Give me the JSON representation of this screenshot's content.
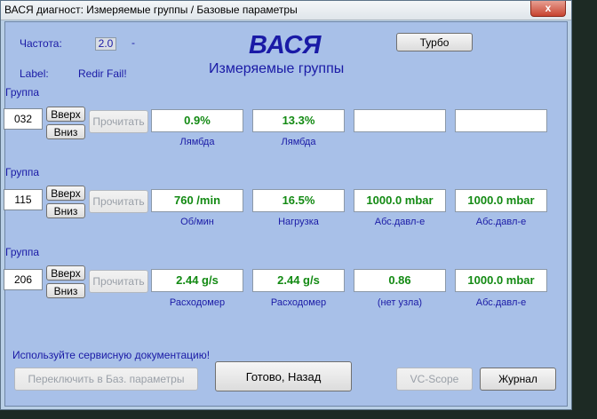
{
  "window": {
    "title": "ВАСЯ диагност: Измеряемые группы / Базовые параметры",
    "close_glyph": "x"
  },
  "header": {
    "freq_label": "Частота:",
    "freq_value": "2.0",
    "freq_dash": "-",
    "label_caption": "Label:",
    "label_value": "Redir Fail!",
    "brand": "ВАСЯ",
    "subtitle": "Измеряемые группы",
    "turbo_button": "Турбо"
  },
  "groups": [
    {
      "caption": "Группа",
      "number": "032",
      "up_button": "Вверх",
      "down_button": "Вниз",
      "read_button": "Прочитать",
      "values": [
        {
          "value": "0.9%",
          "label": "Лямбда"
        },
        {
          "value": "13.3%",
          "label": "Лямбда"
        },
        {
          "value": "",
          "label": ""
        },
        {
          "value": "",
          "label": ""
        }
      ]
    },
    {
      "caption": "Группа",
      "number": "115",
      "up_button": "Вверх",
      "down_button": "Вниз",
      "read_button": "Прочитать",
      "values": [
        {
          "value": "760 /min",
          "label": "Об/мин"
        },
        {
          "value": "16.5%",
          "label": "Нагрузка"
        },
        {
          "value": "1000.0 mbar",
          "label": "Абс.давл-е"
        },
        {
          "value": "1000.0 mbar",
          "label": "Абс.давл-е"
        }
      ]
    },
    {
      "caption": "Группа",
      "number": "206",
      "up_button": "Вверх",
      "down_button": "Вниз",
      "read_button": "Прочитать",
      "values": [
        {
          "value": "2.44 g/s",
          "label": "Расходомер"
        },
        {
          "value": "2.44 g/s",
          "label": "Расходомер"
        },
        {
          "value": "0.86",
          "label": "(нет узла)"
        },
        {
          "value": "1000.0 mbar",
          "label": "Абс.давл-е"
        }
      ]
    }
  ],
  "footer": {
    "hint": "Используйте сервисную документацию!",
    "switch_button": "Переключить в Баз. параметры",
    "done_button": "Готово, Назад",
    "vcscope_button": "VC-Scope",
    "journal_button": "Журнал"
  },
  "colors": {
    "panel_bg": "#a8c0e8",
    "label_blue": "#1a1aa6",
    "value_green": "#138a13"
  }
}
